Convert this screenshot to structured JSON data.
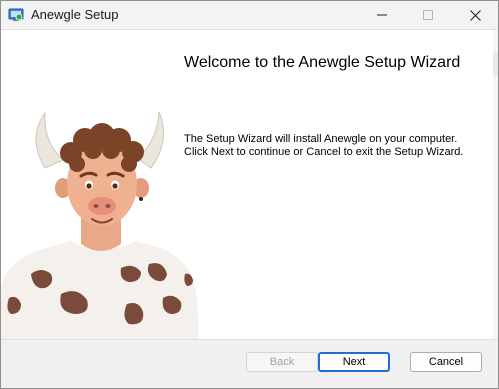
{
  "window": {
    "title": "Anewgle Setup"
  },
  "titlebar": {
    "app_icon": "setup-installer-icon",
    "minimize_icon": "minimize-icon",
    "maximize_icon": "maximize-icon",
    "close_icon": "close-icon"
  },
  "welcome": {
    "heading": "Welcome to the Anewgle Setup Wizard",
    "body": "The Setup Wizard will install Anewgle on your computer. Click Next to continue or Cancel to exit the Setup Wizard."
  },
  "illustration": {
    "subject": "cow-horned cartoon man mascot"
  },
  "footer": {
    "back_label": "Back",
    "next_label": "Next",
    "cancel_label": "Cancel",
    "back_enabled": false
  },
  "colors": {
    "titlebar_bg": "#f3f3f3",
    "footer_bg": "#f0f0f0",
    "default_button_border": "#1f6fcf"
  }
}
